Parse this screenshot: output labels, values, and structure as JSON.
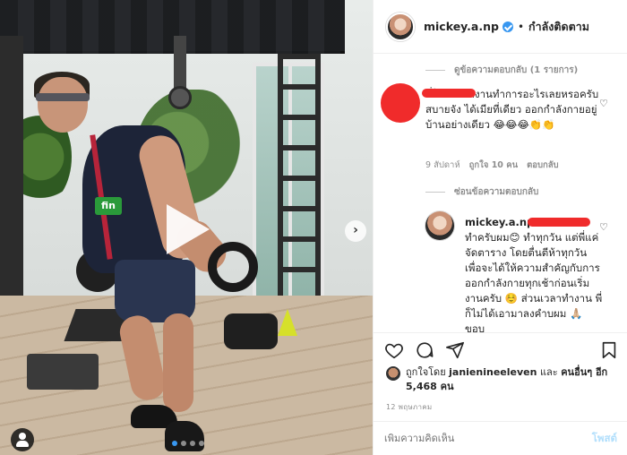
{
  "header": {
    "username": "mickey.a.np",
    "separator": "•",
    "follow_status": "กำลังติดตาม"
  },
  "comments": {
    "hide_replies_label": "ดูข้อความตอบกลับ (1 รายการ)",
    "comment1_text": "พี่ไม่ต้องทำงานทำการอะไรเลยหรอครับ สบายจัง ได้เมียที่เดียว ออกกำลังกายอยู่บ้านอย่างเดียว 😂😂😂👏👏",
    "comment1_time": "9 สัปดาห์",
    "comment1_likes": "ถูกใจ 10 คน",
    "comment1_reply": "ตอบกลับ",
    "hide_replies2_label": "ซ่อนข้อความตอบกลับ",
    "reply_username": "mickey.a.np",
    "reply_text": "ทำครับผม😊 ทำทุกวัน แต่พี่แค่จัดตาราง โดยตื่นตีห้าทุกวัน เพื่อจะได้ให้ความสำคัญกับการออกกำลังกายทุกเช้าก่อนเริ่มงานครับ ☺️ ส่วนเวลาทำงาน พี่ก็ไม่ได้เอามาลงคำบผม 🙏🏼 ขอบ"
  },
  "likes": {
    "prefix": "ถูกใจโดย",
    "liker": "janienineeleven",
    "middle": "และ",
    "others": "คนอื่นๆ อีก 5,468 คน"
  },
  "date": "12 พฤษภาคม",
  "composer": {
    "placeholder": "เพิ่มความคิดเห็น",
    "post_label": "โพสต์"
  },
  "media": {
    "badge_text": "fin",
    "next_arrow": "›"
  },
  "icons": {
    "heart": "heart-icon",
    "comment": "comment-icon",
    "share": "share-icon",
    "bookmark": "bookmark-icon"
  },
  "colors": {
    "accent": "#3897f0",
    "post_disabled": "#b2dffc",
    "muted": "#8e8e8e",
    "redaction": "#f02b2b"
  }
}
